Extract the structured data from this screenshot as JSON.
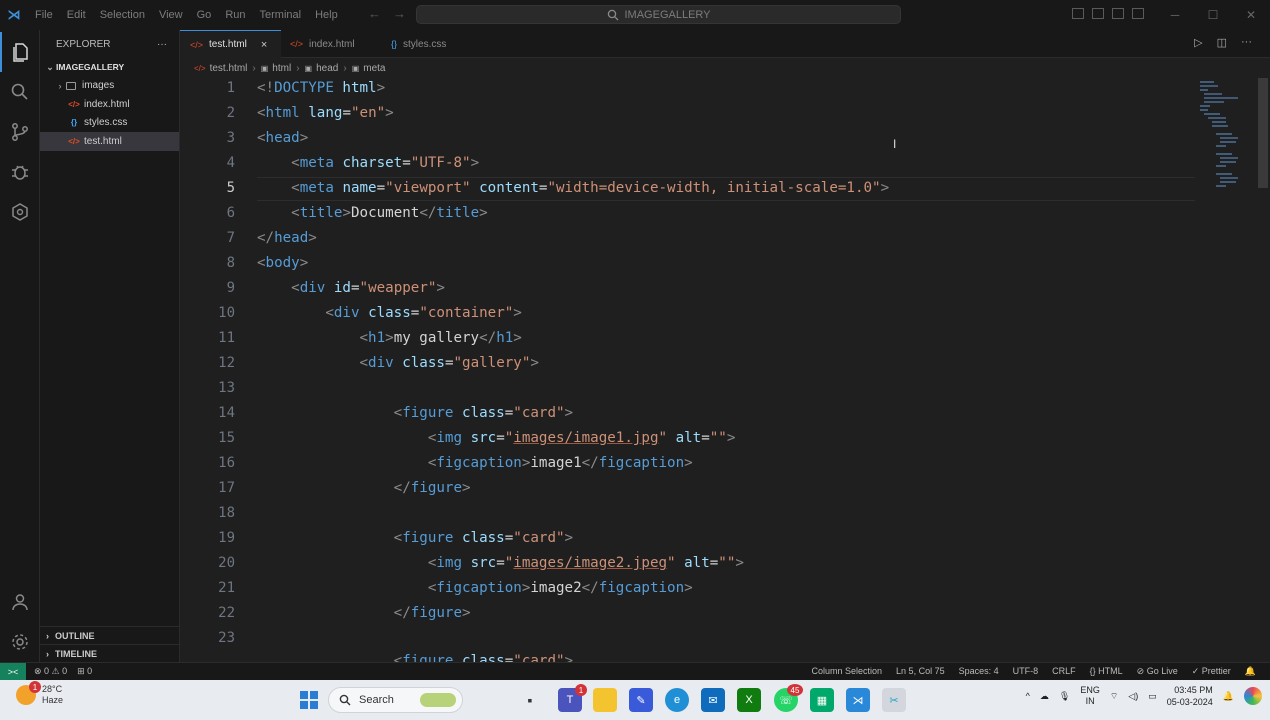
{
  "window": {
    "menu": [
      "File",
      "Edit",
      "Selection",
      "View",
      "Go",
      "Run",
      "Terminal",
      "Help"
    ],
    "command_center": "IMAGEGALLERY"
  },
  "explorer": {
    "title": "EXPLORER",
    "more": "···",
    "root": "IMAGEGALLERY",
    "items": [
      {
        "label": "images",
        "kind": "folder"
      },
      {
        "label": "index.html",
        "kind": "html"
      },
      {
        "label": "styles.css",
        "kind": "css"
      },
      {
        "label": "test.html",
        "kind": "html"
      }
    ],
    "panels": [
      "OUTLINE",
      "TIMELINE"
    ]
  },
  "tabs": [
    {
      "label": "test.html",
      "icon": "</>",
      "close": "×"
    },
    {
      "label": "index.html",
      "icon": "</>"
    },
    {
      "label": "styles.css",
      "icon": "{}"
    }
  ],
  "breadcrumb": [
    "test.html",
    "html",
    "head",
    "meta"
  ],
  "code": {
    "line_numbers": [
      "1",
      "2",
      "3",
      "4",
      "5",
      "6",
      "7",
      "8",
      "9",
      "10",
      "11",
      "12",
      "13",
      "14",
      "15",
      "16",
      "17",
      "18",
      "19",
      "20",
      "21",
      "22",
      "23"
    ],
    "current_line": "5"
  },
  "statusbar": {
    "remote": "><",
    "problems": "⊗ 0 ⚠ 0",
    "ports": "⊞ 0",
    "column_selection": "Column Selection",
    "position": "Ln 5, Col 75",
    "spaces": "Spaces: 4",
    "encoding": "UTF-8",
    "eol": "CRLF",
    "language": "{} HTML",
    "golive": "⊘ Go Live",
    "prettier": "✓ Prettier",
    "bell": "🔔"
  },
  "taskbar": {
    "weather_temp": "28°C",
    "weather_desc": "Haze",
    "weather_badge": "1",
    "search": "Search",
    "lang_top": "ENG",
    "lang_bottom": "IN",
    "time": "03:45 PM",
    "date": "05-03-2024",
    "teams_badge": "1",
    "whatsapp_badge": "45"
  },
  "colors": {
    "accent": "#3c8fd8",
    "tag": "#569cd6",
    "attr": "#9cdcfe",
    "string": "#ce9178",
    "remote": "#16825d"
  }
}
